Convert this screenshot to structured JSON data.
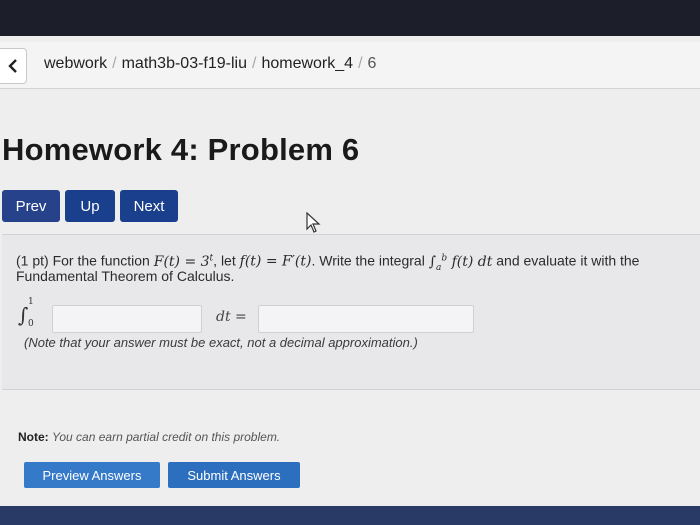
{
  "breadcrumb": {
    "items": [
      "webwork",
      "math3b-03-f19-liu",
      "homework_4",
      "6"
    ]
  },
  "page": {
    "title": "Homework 4: Problem 6"
  },
  "nav": {
    "prev": "Prev",
    "up": "Up",
    "next": "Next"
  },
  "problem": {
    "pts": "(1 pt) For the function",
    "F_expr": "F(t) = 3",
    "F_exp": "t",
    "let_text": ", let",
    "f_expr": "f(t) = F′(t)",
    "write_text": ". Write the integral",
    "integral_lower": "a",
    "integral_upper": "b",
    "integrand": "f(t) dt",
    "evaluate_text": "and evaluate it with the",
    "line2": "Fundamental Theorem of Calculus.",
    "answer_int_lower": "0",
    "answer_int_upper": "1",
    "dt_label": "dt =",
    "exact_note": "(Note that your answer must be exact, not a decimal approximation.)"
  },
  "credit": {
    "label": "Note:",
    "text": "You can earn partial credit on this problem."
  },
  "actions": {
    "preview": "Preview Answers",
    "submit": "Submit Answers"
  },
  "colors": {
    "nav_button": "#1a3f8c",
    "action_button": "#2f74c7"
  }
}
